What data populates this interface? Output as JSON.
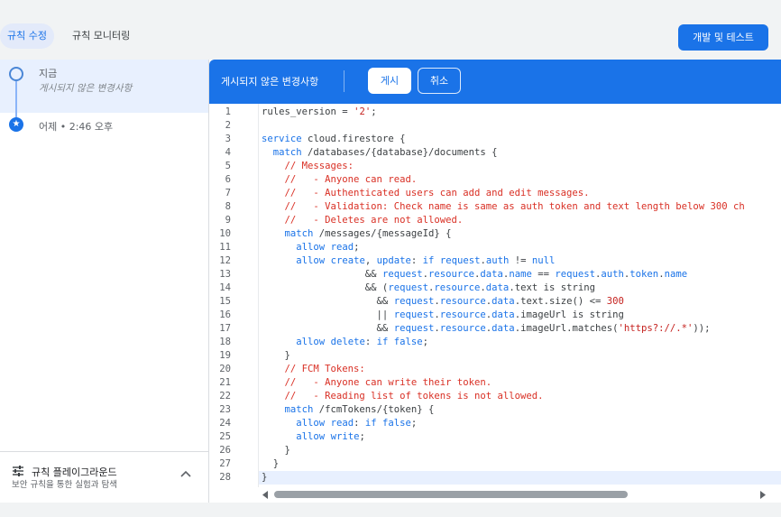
{
  "tabs": {
    "edit_rules": "규칙 수정",
    "monitor_rules": "규칙 모니터링"
  },
  "dev_button": "개발 및 테스트",
  "history": {
    "current_title": "지금",
    "current_subtitle": "게시되지 않은 변경사항",
    "previous_title": "어제 • 2:46 오후"
  },
  "playground": {
    "title": "규칙 플레이그라운드",
    "subtitle": "보안 규칙을 통한 실험과 탐색"
  },
  "editor": {
    "status": "게시되지 않은 변경사항",
    "publish_label": "게시",
    "cancel_label": "취소",
    "current_line": 28,
    "lines": [
      [
        [
          "pl",
          "rules_version = "
        ],
        [
          "st",
          "'2'"
        ],
        [
          "pl",
          ";"
        ]
      ],
      [],
      [
        [
          "kw",
          "service"
        ],
        [
          "pl",
          " cloud.firestore {"
        ]
      ],
      [
        [
          "pl",
          "  "
        ],
        [
          "kw",
          "match"
        ],
        [
          "pl",
          " /databases/{database}/documents {"
        ]
      ],
      [
        [
          "cm",
          "    // Messages:"
        ]
      ],
      [
        [
          "cm",
          "    //   - Anyone can read."
        ]
      ],
      [
        [
          "cm",
          "    //   - Authenticated users can add and edit messages."
        ]
      ],
      [
        [
          "cm",
          "    //   - Validation: Check name is same as auth token and text length below 300 ch"
        ]
      ],
      [
        [
          "cm",
          "    //   - Deletes are not allowed."
        ]
      ],
      [
        [
          "pl",
          "    "
        ],
        [
          "kw",
          "match"
        ],
        [
          "pl",
          " /messages/{messageId} {"
        ]
      ],
      [
        [
          "pl",
          "      "
        ],
        [
          "kw",
          "allow"
        ],
        [
          "pl",
          " "
        ],
        [
          "kw",
          "read"
        ],
        [
          "pl",
          ";"
        ]
      ],
      [
        [
          "pl",
          "      "
        ],
        [
          "kw",
          "allow"
        ],
        [
          "pl",
          " "
        ],
        [
          "kw",
          "create"
        ],
        [
          "pl",
          ", "
        ],
        [
          "kw",
          "update"
        ],
        [
          "pl",
          ": "
        ],
        [
          "kw",
          "if"
        ],
        [
          "pl",
          " "
        ],
        [
          "kw",
          "request"
        ],
        [
          "pl",
          "."
        ],
        [
          "kw",
          "auth"
        ],
        [
          "pl",
          " != "
        ],
        [
          "kw",
          "null"
        ]
      ],
      [
        [
          "pl",
          "                  && "
        ],
        [
          "kw",
          "request"
        ],
        [
          "pl",
          "."
        ],
        [
          "kw",
          "resource"
        ],
        [
          "pl",
          "."
        ],
        [
          "kw",
          "data"
        ],
        [
          "pl",
          "."
        ],
        [
          "kw",
          "name"
        ],
        [
          "pl",
          " == "
        ],
        [
          "kw",
          "request"
        ],
        [
          "pl",
          "."
        ],
        [
          "kw",
          "auth"
        ],
        [
          "pl",
          "."
        ],
        [
          "kw",
          "token"
        ],
        [
          "pl",
          "."
        ],
        [
          "kw",
          "name"
        ]
      ],
      [
        [
          "pl",
          "                  && ("
        ],
        [
          "kw",
          "request"
        ],
        [
          "pl",
          "."
        ],
        [
          "kw",
          "resource"
        ],
        [
          "pl",
          "."
        ],
        [
          "kw",
          "data"
        ],
        [
          "pl",
          ".text is string"
        ]
      ],
      [
        [
          "pl",
          "                    && "
        ],
        [
          "kw",
          "request"
        ],
        [
          "pl",
          "."
        ],
        [
          "kw",
          "resource"
        ],
        [
          "pl",
          "."
        ],
        [
          "kw",
          "data"
        ],
        [
          "pl",
          ".text.size() <= "
        ],
        [
          "nm",
          "300"
        ]
      ],
      [
        [
          "pl",
          "                    || "
        ],
        [
          "kw",
          "request"
        ],
        [
          "pl",
          "."
        ],
        [
          "kw",
          "resource"
        ],
        [
          "pl",
          "."
        ],
        [
          "kw",
          "data"
        ],
        [
          "pl",
          ".imageUrl is string"
        ]
      ],
      [
        [
          "pl",
          "                    && "
        ],
        [
          "kw",
          "request"
        ],
        [
          "pl",
          "."
        ],
        [
          "kw",
          "resource"
        ],
        [
          "pl",
          "."
        ],
        [
          "kw",
          "data"
        ],
        [
          "pl",
          ".imageUrl.matches("
        ],
        [
          "st",
          "'https?://.*'"
        ],
        [
          "pl",
          "));"
        ]
      ],
      [
        [
          "pl",
          "      "
        ],
        [
          "kw",
          "allow"
        ],
        [
          "pl",
          " "
        ],
        [
          "kw",
          "delete"
        ],
        [
          "pl",
          ": "
        ],
        [
          "kw",
          "if"
        ],
        [
          "pl",
          " "
        ],
        [
          "kw",
          "false"
        ],
        [
          "pl",
          ";"
        ]
      ],
      [
        [
          "pl",
          "    }"
        ]
      ],
      [
        [
          "cm",
          "    // FCM Tokens:"
        ]
      ],
      [
        [
          "cm",
          "    //   - Anyone can write their token."
        ]
      ],
      [
        [
          "cm",
          "    //   - Reading list of tokens is not allowed."
        ]
      ],
      [
        [
          "pl",
          "    "
        ],
        [
          "kw",
          "match"
        ],
        [
          "pl",
          " /fcmTokens/{token} {"
        ]
      ],
      [
        [
          "pl",
          "      "
        ],
        [
          "kw",
          "allow"
        ],
        [
          "pl",
          " "
        ],
        [
          "kw",
          "read"
        ],
        [
          "pl",
          ": "
        ],
        [
          "kw",
          "if"
        ],
        [
          "pl",
          " "
        ],
        [
          "kw",
          "false"
        ],
        [
          "pl",
          ";"
        ]
      ],
      [
        [
          "pl",
          "      "
        ],
        [
          "kw",
          "allow"
        ],
        [
          "pl",
          " "
        ],
        [
          "kw",
          "write"
        ],
        [
          "pl",
          ";"
        ]
      ],
      [
        [
          "pl",
          "    }"
        ]
      ],
      [
        [
          "pl",
          "  }"
        ]
      ],
      [
        [
          "pl",
          "}"
        ]
      ]
    ]
  },
  "colors": {
    "accent": "#1a73e8",
    "keyword": "#1a73e8",
    "comment": "#d93025",
    "string": "#c5221f"
  },
  "icons": {
    "history_current": "circle-icon",
    "history_previous": "star-circle-icon",
    "playground": "sliders-icon",
    "collapse": "chevron-up-icon",
    "scroll_left": "caret-left-icon",
    "scroll_right": "caret-right-icon"
  }
}
